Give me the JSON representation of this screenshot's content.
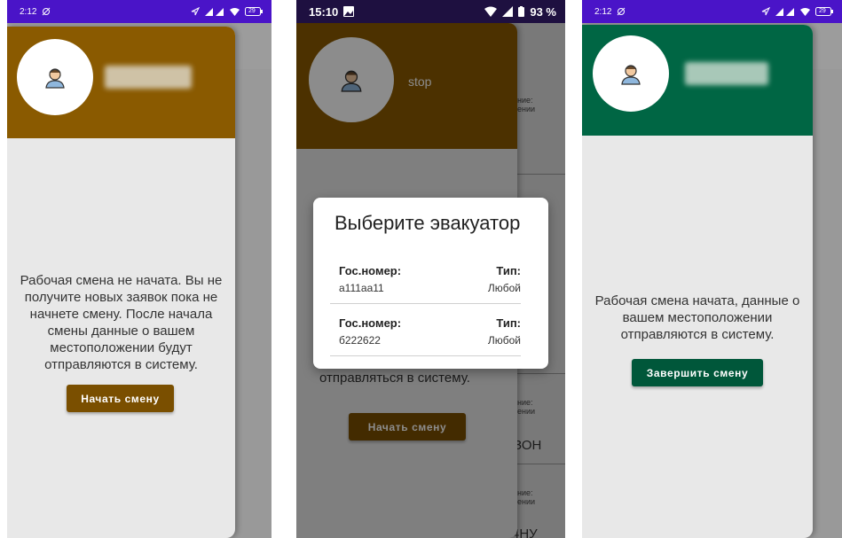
{
  "phones": [
    {
      "status_time": "2:12",
      "status_battery": "29",
      "header_color": "#8a5a00",
      "drawer_message": "Рабочая смена не начата. Вы не получите новых заявок пока не начнете смену. После начала смены данные о вашем местоположении будут отправляются в систему.",
      "action_button": "Начать смену",
      "button_color": "#7a4f00"
    },
    {
      "status_time": "15:10",
      "status_battery": "93 %",
      "header_color": "#5a3e00",
      "username": "stop",
      "bg_list_fragments": [
        "ние:",
        "ении",
        "ние:",
        "ении",
        "ЗОН",
        "ние:",
        "ении",
        "4НУ"
      ],
      "bg_message_fragment": "отправляться в систему.",
      "bg_button": "Начать смену",
      "dialog": {
        "title": "Выберите эвакуатор",
        "vehicles": [
          {
            "plate_label": "Гос.номер:",
            "plate": "а111аа11",
            "type_label": "Тип:",
            "type": "Любой"
          },
          {
            "plate_label": "Гос.номер:",
            "plate": "б222622",
            "type_label": "Тип:",
            "type": "Любой"
          }
        ]
      }
    },
    {
      "status_time": "2:12",
      "status_battery": "29",
      "header_color": "#006644",
      "drawer_message": "Рабочая смена начата, данные о вашем местоположении отправляются в систему.",
      "action_button": "Завершить смену",
      "button_color": "#00573a"
    }
  ],
  "icons": [
    "user-avatar-icon",
    "picture-notification-icon",
    "alarm-icon",
    "location-icon",
    "signal-icon",
    "wifi-icon",
    "battery-icon"
  ]
}
